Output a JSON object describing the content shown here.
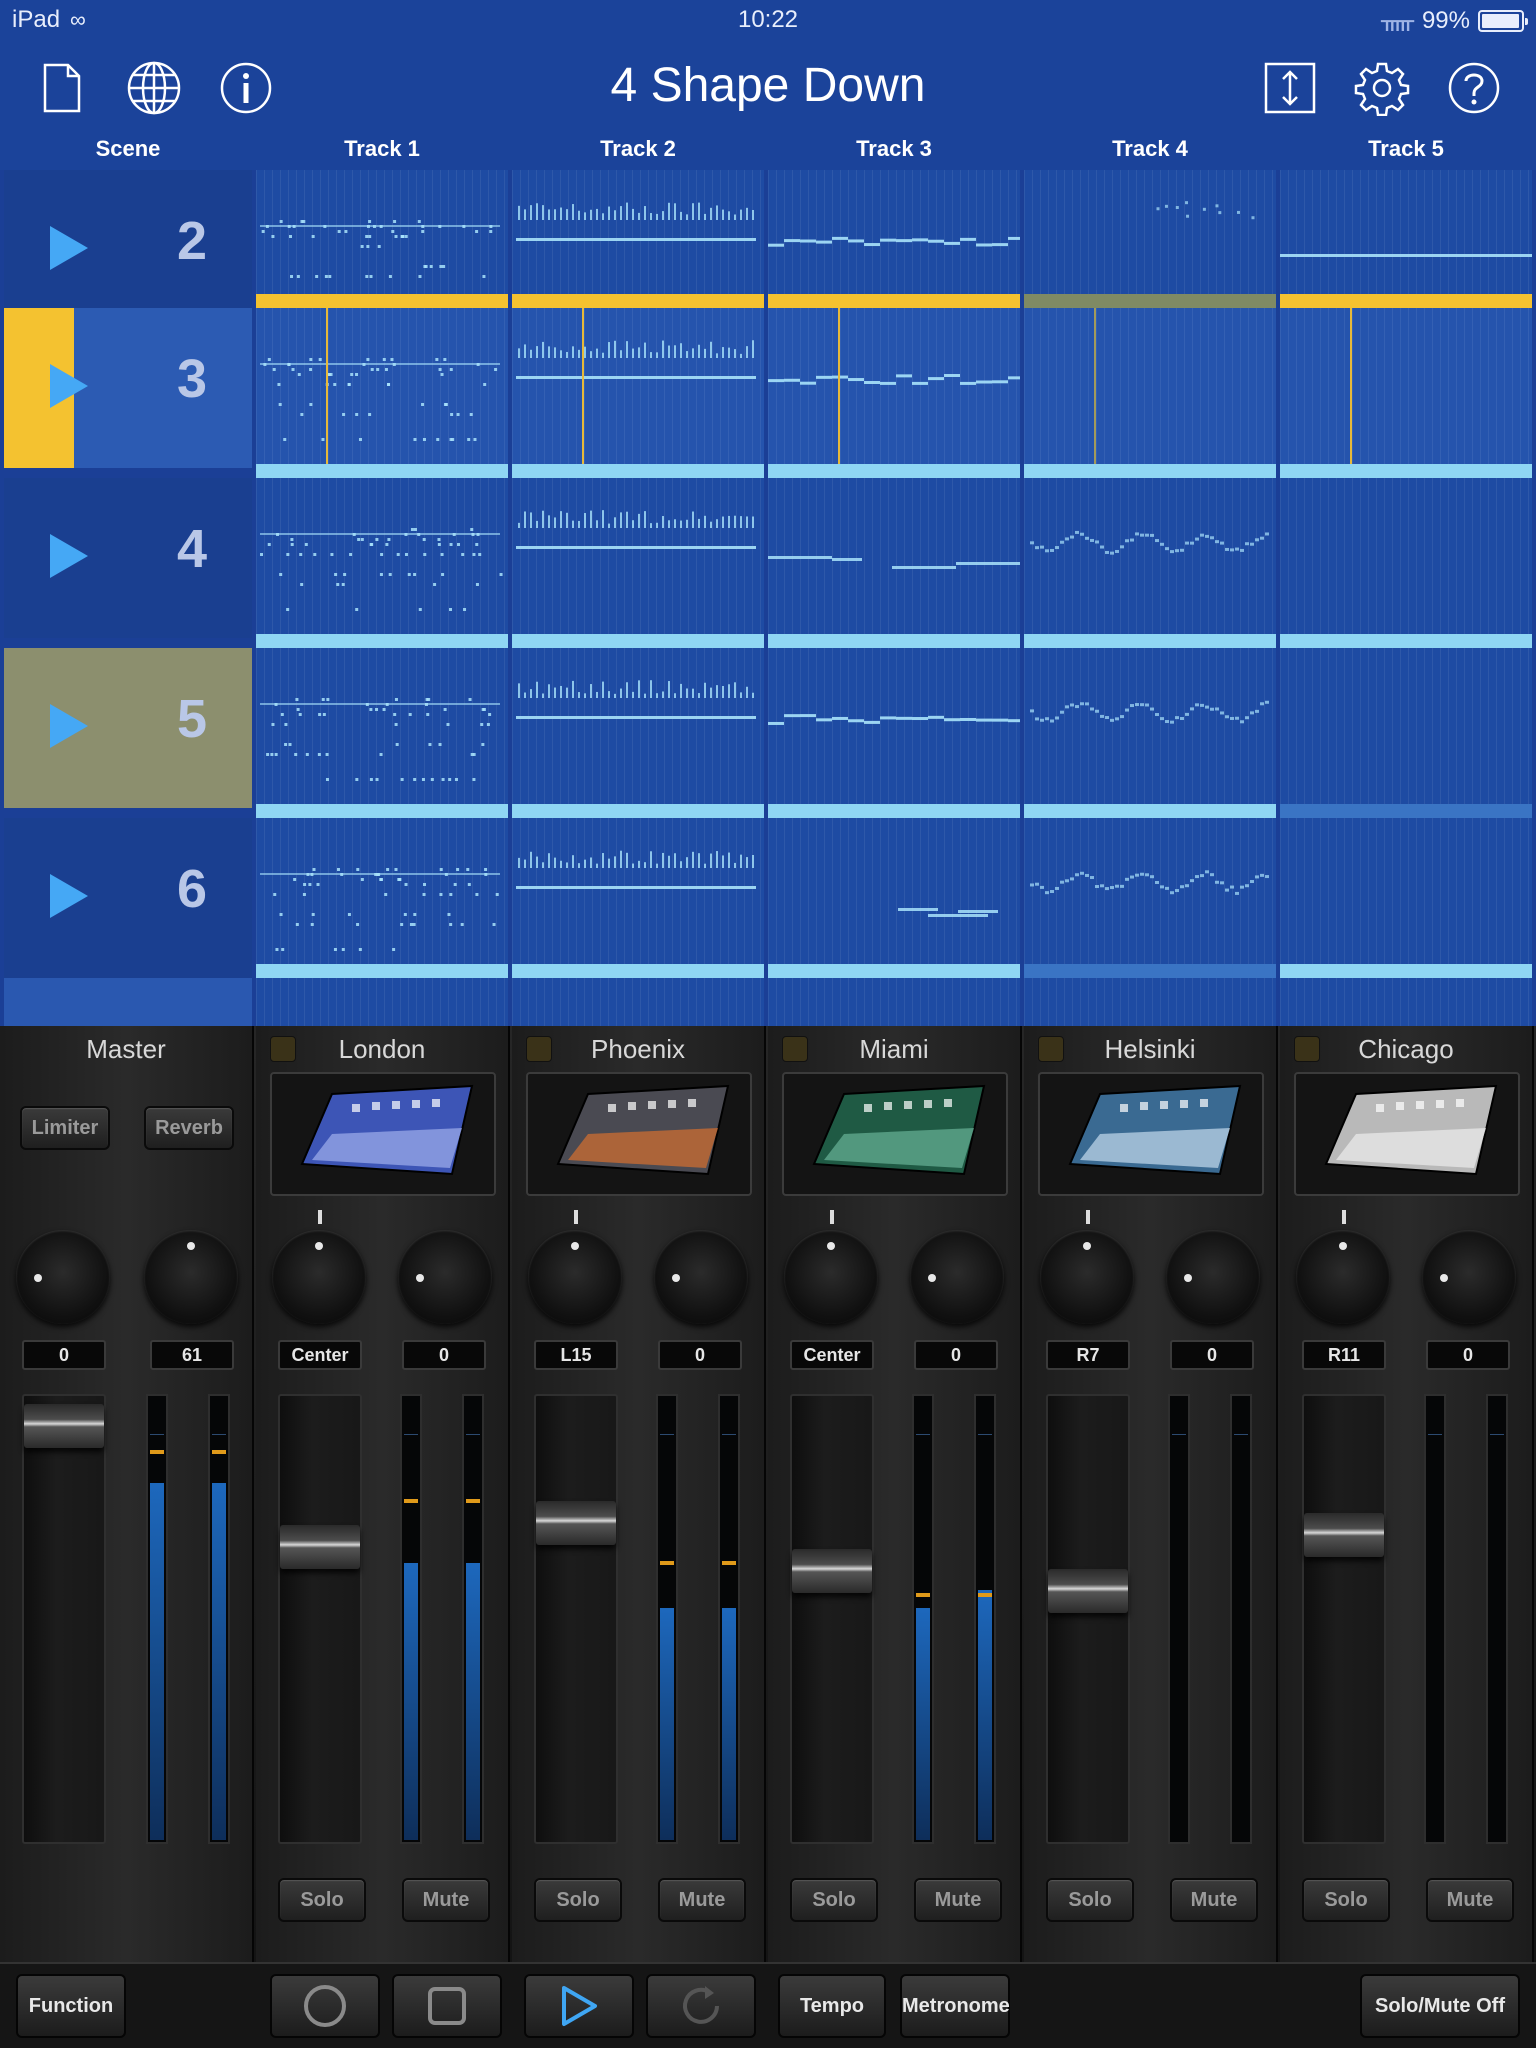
{
  "status": {
    "device": "iPad",
    "time": "10:22",
    "battery": "99%"
  },
  "toolbar": {
    "title": "4 Shape Down",
    "icons_left": [
      "new-document-icon",
      "globe-icon",
      "info-icon"
    ],
    "icons_right": [
      "resize-vertical-icon",
      "gear-icon",
      "help-icon"
    ]
  },
  "columns": [
    "Scene",
    "Track 1",
    "Track 2",
    "Track 3",
    "Track 4",
    "Track 5"
  ],
  "scenes": [
    {
      "number": "2",
      "highlight": "none"
    },
    {
      "number": "3",
      "highlight": "playing"
    },
    {
      "number": "4",
      "highlight": "none"
    },
    {
      "number": "5",
      "highlight": "queued"
    },
    {
      "number": "6",
      "highlight": "none"
    }
  ],
  "colors": {
    "header": "#1b439a",
    "grid": "#1e4ba3",
    "playing": "#f4c230",
    "queued": "#8c8f6e",
    "clip_bar": "#8fd6f3",
    "play_arrow": "#45a8f5",
    "meter_peak": "#e09a1a"
  },
  "mixer": {
    "master": {
      "name": "Master",
      "limiter": "Limiter",
      "reverb": "Reverb",
      "value_left": "0",
      "value_right": "61",
      "fader_level": 0.98,
      "meter_levels": [
        0.8,
        0.8
      ],
      "peak_levels": [
        0.87,
        0.87
      ]
    },
    "tracks": [
      {
        "name": "London",
        "pan": "Center",
        "send": "0",
        "fader_level": 0.68,
        "meter_levels": [
          0.62,
          0.62
        ],
        "peak_levels": [
          0.76,
          0.76
        ],
        "solo": "Solo",
        "mute": "Mute"
      },
      {
        "name": "Phoenix",
        "pan": "L15",
        "send": "0",
        "fader_level": 0.74,
        "meter_levels": [
          0.52,
          0.52
        ],
        "peak_levels": [
          0.62,
          0.62
        ],
        "solo": "Solo",
        "mute": "Mute"
      },
      {
        "name": "Miami",
        "pan": "Center",
        "send": "0",
        "fader_level": 0.62,
        "meter_levels": [
          0.52,
          0.56
        ],
        "peak_levels": [
          0.55,
          0.55
        ],
        "solo": "Solo",
        "mute": "Mute"
      },
      {
        "name": "Helsinki",
        "pan": "R7",
        "send": "0",
        "fader_level": 0.57,
        "meter_levels": [
          0,
          0
        ],
        "peak_levels": [
          null,
          null
        ],
        "solo": "Solo",
        "mute": "Mute"
      },
      {
        "name": "Chicago",
        "pan": "R11",
        "send": "0",
        "fader_level": 0.71,
        "meter_levels": [
          0,
          0
        ],
        "peak_levels": [
          null,
          null
        ],
        "solo": "Solo",
        "mute": "Mute"
      }
    ]
  },
  "transport": {
    "function": "Function",
    "tempo": "Tempo",
    "metronome": "Metronome",
    "solo_mute_off": "Solo/Mute Off",
    "icons": [
      "record-icon",
      "stop-icon",
      "play-icon",
      "loop-icon"
    ]
  }
}
